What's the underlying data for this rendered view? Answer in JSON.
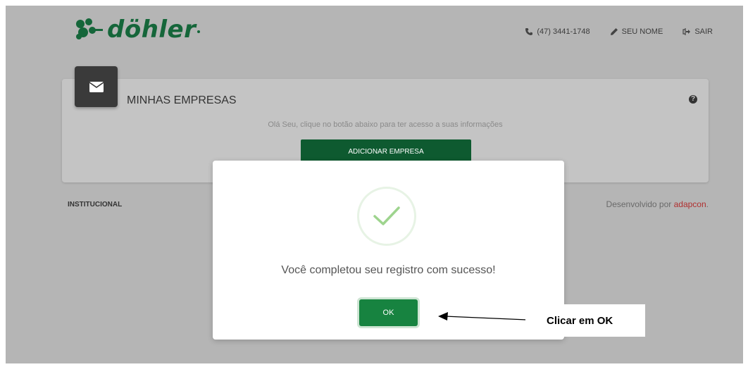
{
  "header": {
    "logo_text": "döhler",
    "phone": "(47) 3441-1748",
    "user_name": "SEU NOME",
    "logout": "SAIR"
  },
  "card": {
    "title": "MINHAS EMPRESAS",
    "help": "?",
    "text": "Olá Seu, clique no botão abaixo para ter acesso a suas informações",
    "add_button": "ADICIONAR EMPRESA"
  },
  "footer": {
    "institucional": "INSTITUCIONAL",
    "developed_by": "Desenvolvido por",
    "developer": "adapcon",
    "period": "."
  },
  "modal": {
    "message": "Você completou seu registro com sucesso!",
    "ok_button": "OK"
  },
  "annotation": {
    "text": "Clicar em OK"
  },
  "colors": {
    "brand_green": "#15663a",
    "button_green": "#178340",
    "link_red": "#b03030"
  }
}
